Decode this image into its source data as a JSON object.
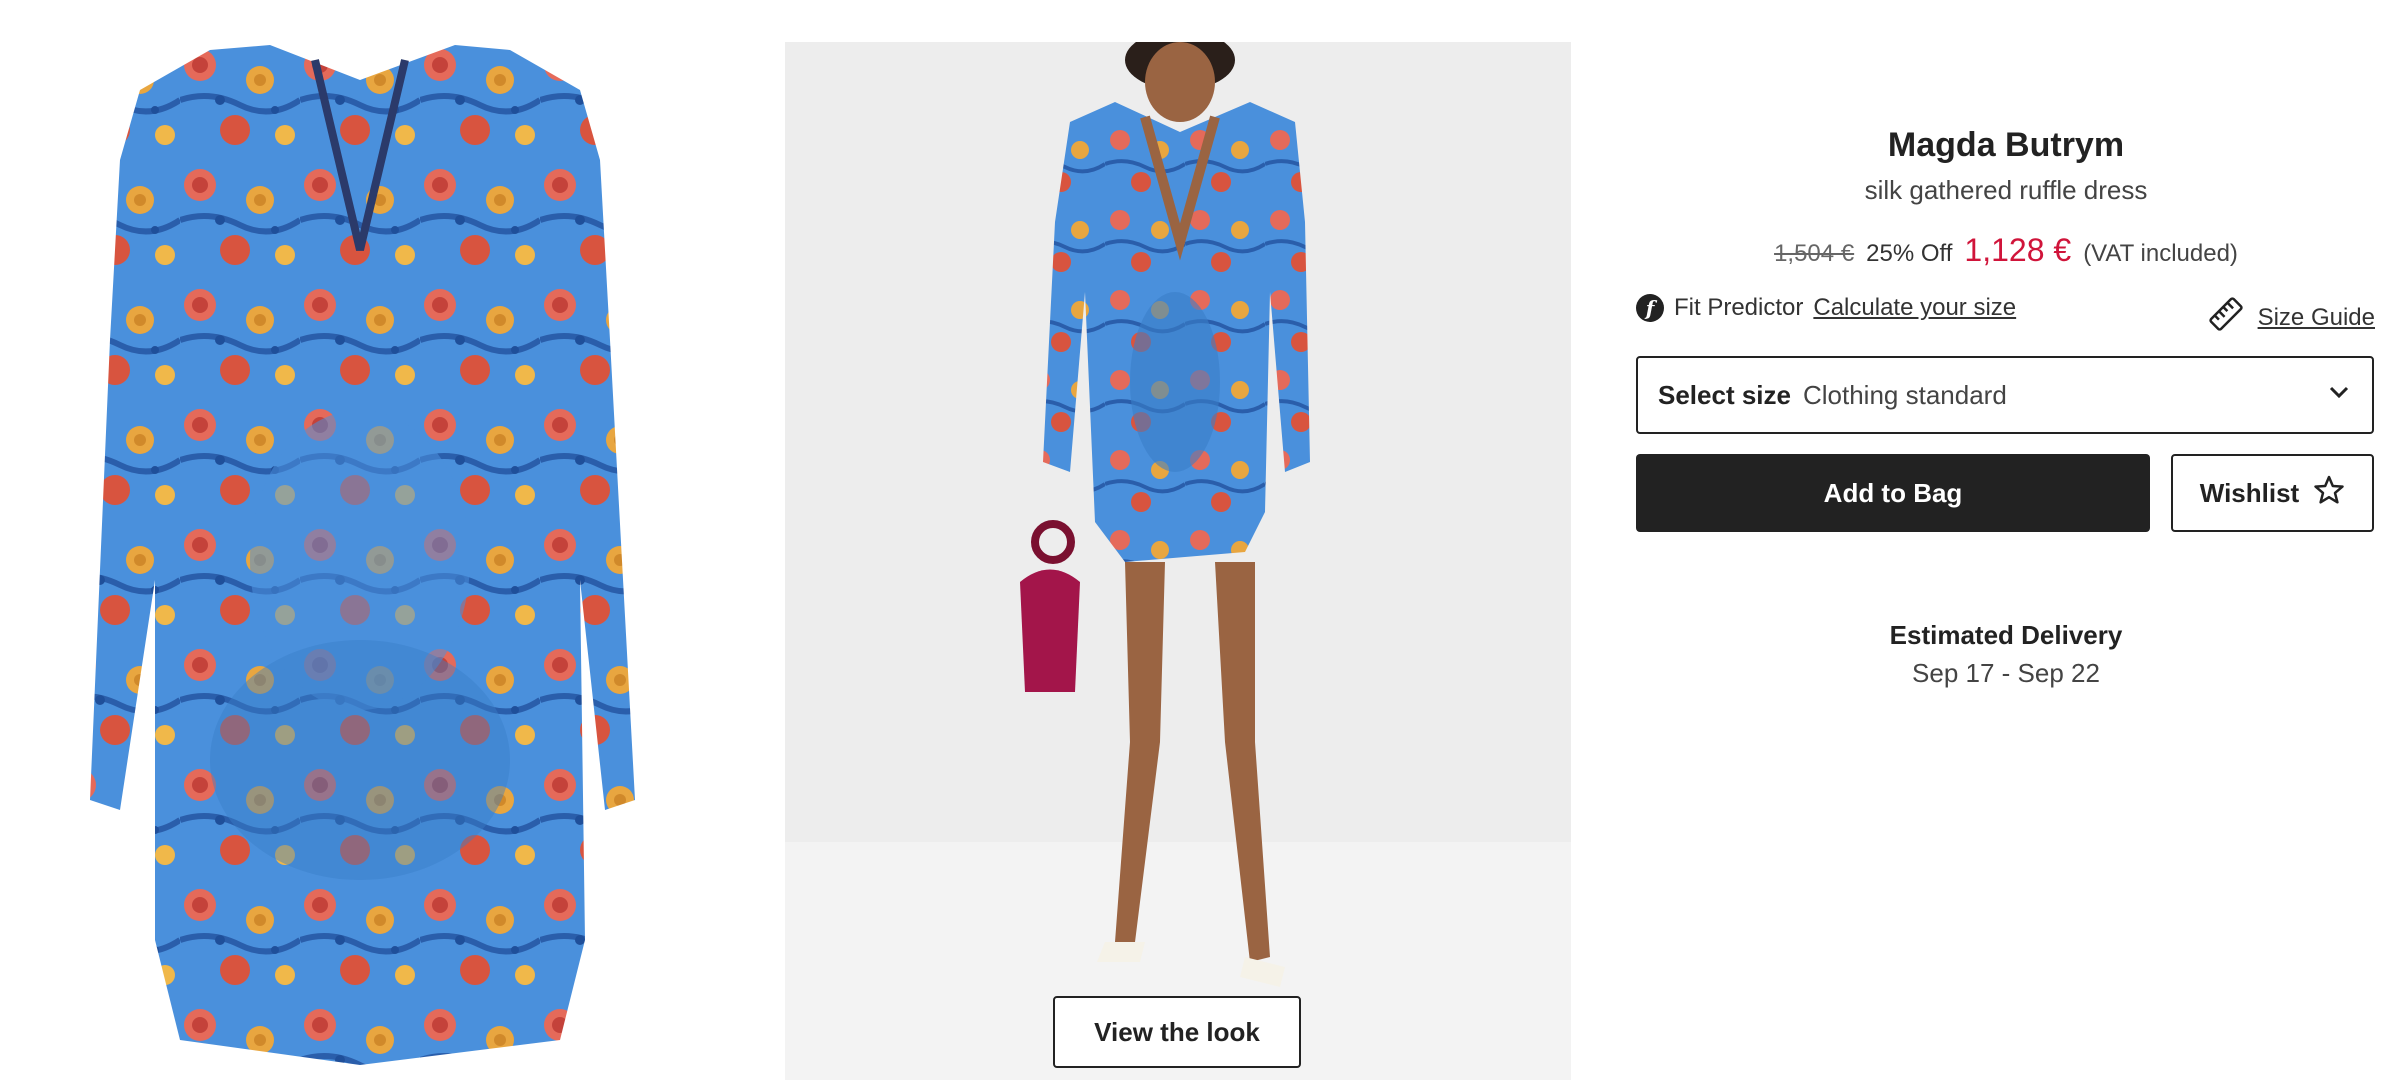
{
  "product": {
    "brand": "Magda Butrym",
    "description": "silk gathered ruffle dress",
    "old_price": "1,504 €",
    "discount": "25% Off",
    "new_price": "1,128 €",
    "vat_note": "(VAT included)"
  },
  "fit": {
    "logo_letter": "f",
    "label": "Fit Predictor",
    "link": "Calculate your size"
  },
  "size_guide": {
    "label": "Size Guide"
  },
  "size_select": {
    "label": "Select size",
    "value": "Clothing standard"
  },
  "actions": {
    "add_to_bag": "Add to Bag",
    "wishlist": "Wishlist"
  },
  "delivery": {
    "title": "Estimated Delivery",
    "dates": "Sep 17 - Sep 22"
  },
  "gallery": {
    "view_look": "View the look"
  },
  "colors": {
    "price_red": "#d0143a",
    "dark": "#222222",
    "dress_blue": "#3e8ad8"
  },
  "icons": [
    "fit-predictor-logo-icon",
    "ruler-icon",
    "chevron-down-icon",
    "star-icon"
  ]
}
